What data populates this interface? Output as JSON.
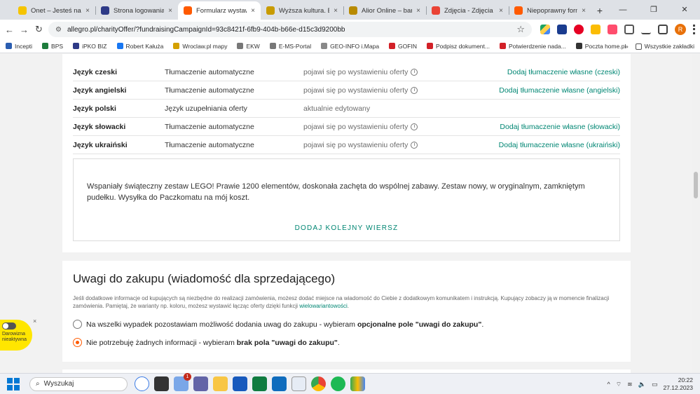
{
  "browser": {
    "tabs": [
      {
        "title": "Onet – Jesteś na bieżąco",
        "color": "#f5c400",
        "active": false
      },
      {
        "title": "Strona logowania | iPKO",
        "color": "#2e3a87",
        "active": false
      },
      {
        "title": "Formularz wystawiania",
        "color": "#ff5a00",
        "active": true
      },
      {
        "title": "Wyższa kultura. Bank",
        "color": "#c89b00",
        "active": false
      },
      {
        "title": "Alior Online – bankowość",
        "color": "#b88a00",
        "active": false
      },
      {
        "title": "Zdjęcia - Zdjęcia Google",
        "color": "#ea4335",
        "active": false
      },
      {
        "title": "Niepoprawny formularz",
        "color": "#ff5a00",
        "active": false
      }
    ],
    "close_glyph": "×",
    "new_tab_glyph": "+",
    "window_controls": [
      "—",
      "❐",
      "✕"
    ],
    "url": "allegro.pl/charityOffer/?fundraisingCampaignId=93c8421f-6fb9-404b-b66e-d15c3d9200bb",
    "profile_initial": "R",
    "bookmarks": [
      {
        "label": "Incepti",
        "color": "#2a5db0"
      },
      {
        "label": "BPS",
        "color": "#1d7c3c"
      },
      {
        "label": "iPKO BIZ",
        "color": "#2e3a87"
      },
      {
        "label": "Robert Kałuża",
        "color": "#1877f2"
      },
      {
        "label": "Wroclaw.pl mapy",
        "color": "#d4a000"
      },
      {
        "label": "EKW",
        "color": "#777777"
      },
      {
        "label": "E-MS-Portal",
        "color": "#777777"
      },
      {
        "label": "GEO-INFO i.Mapa",
        "color": "#888888"
      },
      {
        "label": "GOFIN",
        "color": "#d22027"
      },
      {
        "label": "Podpisz dokument...",
        "color": "#d22027"
      },
      {
        "label": "Potwierdzenie nada...",
        "color": "#d22027"
      },
      {
        "label": "Poczta home.pl",
        "color": "#333333"
      }
    ],
    "bookmarks_more": "»",
    "all_bookmarks": "Wszystkie zakładki"
  },
  "languages": [
    {
      "name": "Język czeski",
      "type": "Tłumaczenie automatyczne",
      "status": "pojawi się po wystawieniu oferty",
      "info": true,
      "action": "Dodaj tłumaczenie własne (czeski)"
    },
    {
      "name": "Język angielski",
      "type": "Tłumaczenie automatyczne",
      "status": "pojawi się po wystawieniu oferty",
      "info": true,
      "action": "Dodaj tłumaczenie własne (angielski)"
    },
    {
      "name": "Język polski",
      "type": "Język uzupełniania oferty",
      "status": "aktualnie edytowany",
      "info": false,
      "action": ""
    },
    {
      "name": "Język słowacki",
      "type": "Tłumaczenie automatyczne",
      "status": "pojawi się po wystawieniu oferty",
      "info": true,
      "action": "Dodaj tłumaczenie własne (słowacki)"
    },
    {
      "name": "Język ukraiński",
      "type": "Tłumaczenie automatyczne",
      "status": "pojawi się po wystawieniu oferty",
      "info": true,
      "action": "Dodaj tłumaczenie własne (ukraiński)"
    }
  ],
  "description": {
    "text": "Wspaniały świąteczny zestaw LEGO! Prawie 1200 elementów, doskonała zachęta do wspólnej zabawy. Zestaw nowy, w oryginalnym, zamkniętym pudełku. Wysyłka do Paczkomatu na mój koszt.",
    "add_row": "DODAJ KOLEJNY WIERSZ"
  },
  "purchase_notes": {
    "title": "Uwagi do zakupu (wiadomość dla sprzedającego)",
    "note": "Jeśli dodatkowe informacje od kupujących są niezbędne do realizacji zamówienia, możesz dodać miejsce na wiadomość do Ciebie z dodatkowym komunikatem i instrukcją. Kupujący zobaczy ją w momencie finalizacji zamówienia. Pamiętaj, że warianty np. koloru, możesz wystawić łącząc oferty dzięki funkcji",
    "note_link": "wielowariantowości",
    "note_end": ".",
    "option1_prefix": "Na wszelki wypadek pozostawiam możliwość dodania uwag do zakupu - wybieram ",
    "option1_bold": "opcjonalne pole \"uwagi do zakupu\"",
    "option1_suffix": ".",
    "option2_prefix": "Nie potrzebuję żadnych informacji - wybieram ",
    "option2_bold": "brak pola \"uwagi do zakupu\"",
    "option2_suffix": ".",
    "selected": 2
  },
  "widget": {
    "label": "Darowizna nieaktywna",
    "close": "×"
  },
  "taskbar": {
    "search_placeholder": "Wyszukaj",
    "badge": "1",
    "time": "20:22",
    "date": "27.12.2023"
  },
  "colors": {
    "accent": "#ff5a00",
    "link": "#008673"
  }
}
